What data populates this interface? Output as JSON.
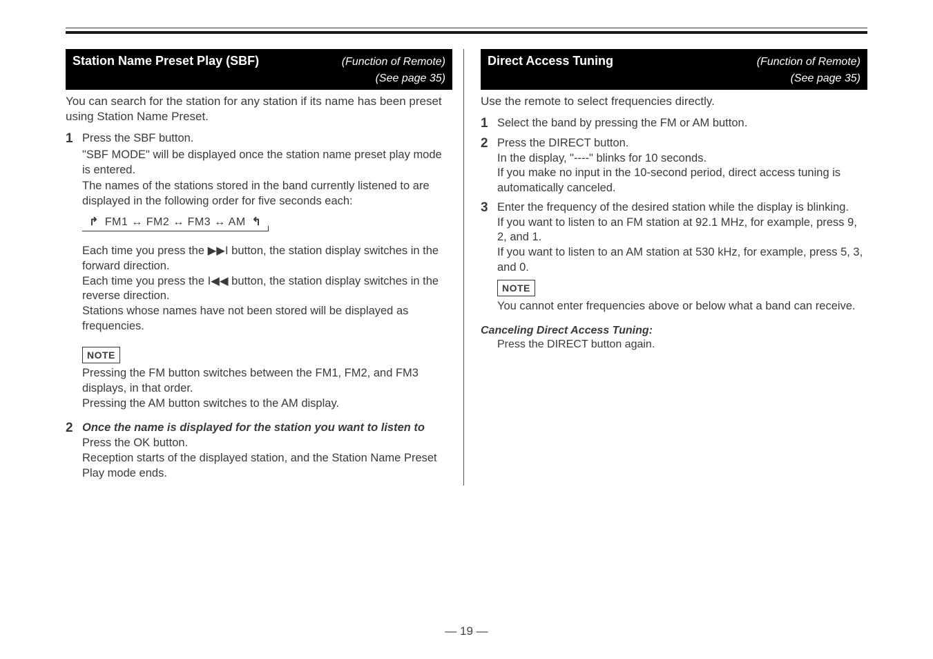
{
  "page_ref": "(See page 35)",
  "function_remote": "(Function of Remote)",
  "note_chip": "NOTE",
  "page_number_text": "— 19 —",
  "left": {
    "bar_title": "Station Name Preset Play (SBF)",
    "lead": "You can search for the station for any station if its name has been preset using Station Name Preset.",
    "step1": {
      "line1": "Press the SBF button.",
      "line2": "\"SBF MODE\" will be displayed once the station name preset play mode is entered.",
      "line3": "The names of the stations stored in the band currently listened to are displayed in the following order for five seconds each:",
      "seq": "FM1 ↔ FM2 ↔ FM3 ↔ AM",
      "p2_a": "Each time you press the ",
      "p2_b": " button, the station display switches in the forward direction.",
      "p3_a": "Each time you press the ",
      "p3_b": " button, the station display switches in the reverse direction.",
      "p4": "Stations whose names have not been stored will be displayed as frequencies.",
      "note_body": "Pressing the FM button switches between the FM1, FM2, and FM3 displays, in that order.\nPressing the AM button switches to the AM display."
    },
    "step2": {
      "emph": "Once the name is displayed for the station you want to listen to",
      "line2": "Press the OK button.",
      "line3": "Reception starts of the displayed station, and the Station Name Preset Play mode ends."
    }
  },
  "right": {
    "bar_title": "Direct Access Tuning",
    "lead": "Use the remote to select frequencies directly.",
    "step1": "Select the band by pressing the FM or AM button.",
    "step2": {
      "line1": "Press the DIRECT button.",
      "line2": "In the display, \"----\" blinks for 10 seconds.",
      "line3": "If you make no input in the 10-second period, direct access tuning is automatically canceled."
    },
    "step3": {
      "line1": "Enter the frequency of the desired station while the display is blinking.",
      "line2": "If you want to listen to an FM station at 92.1 MHz, for example, press 9, 2, and 1.",
      "line3": "If you want to listen to an AM station at 530 kHz, for example, press 5, 3, and 0."
    },
    "note_body": "You cannot enter frequencies above or below what a band can receive.",
    "cancel": {
      "title": "Canceling Direct Access Tuning:",
      "body": "Press the DIRECT button again."
    }
  },
  "icons": {
    "next": "▶▶I",
    "prev": "I◀◀"
  }
}
